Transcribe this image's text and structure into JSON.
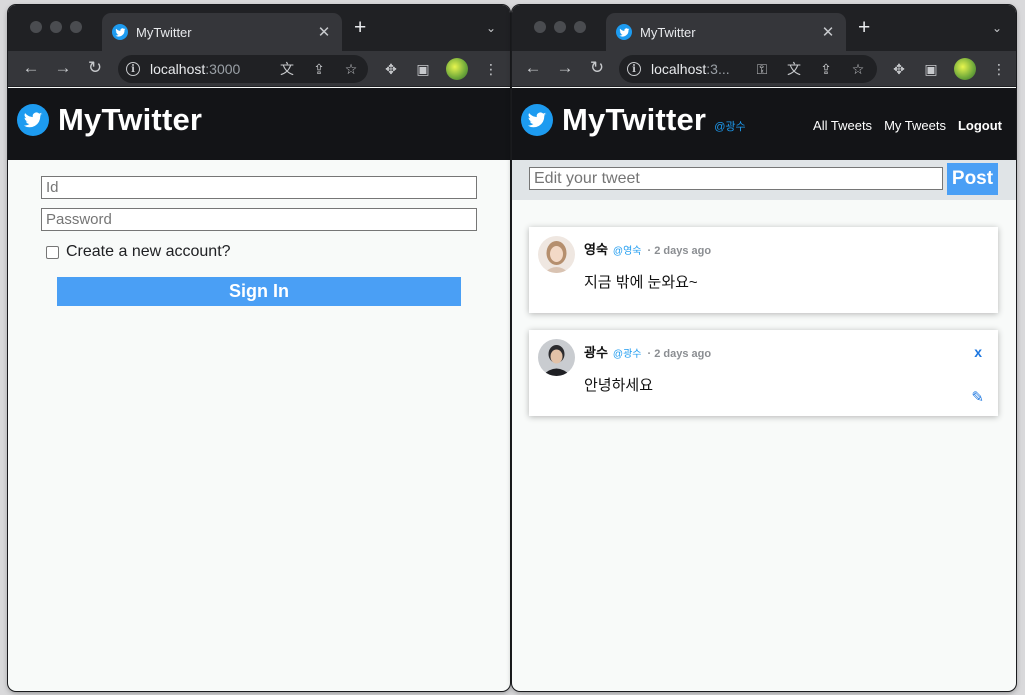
{
  "left_window": {
    "tab_title": "MyTwitter",
    "url_host": "localhost",
    "url_rest": ":3000",
    "app_title": "MyTwitter",
    "login": {
      "id_placeholder": "Id",
      "password_placeholder": "Password",
      "create_account_label": "Create a new account?",
      "create_account_checked": false,
      "signin_label": "Sign In"
    }
  },
  "right_window": {
    "tab_title": "MyTwitter",
    "url_host": "localhost",
    "url_rest": ":3...",
    "app_title": "MyTwitter",
    "user_handle": "@광수",
    "nav": {
      "all_tweets": "All Tweets",
      "my_tweets": "My Tweets",
      "logout": "Logout"
    },
    "composer": {
      "placeholder": "Edit your tweet",
      "post_label": "Post"
    },
    "tweets": [
      {
        "name": "영숙",
        "handle": "@영숙",
        "time": "· 2 days ago",
        "text": "지금 밖에 눈와요~",
        "owned": false
      },
      {
        "name": "광수",
        "handle": "@광수",
        "time": "· 2 days ago",
        "text": "안녕하세요",
        "owned": true,
        "delete_label": "x",
        "edit_label": "✎"
      }
    ]
  },
  "colors": {
    "accent": "#1d9bf0",
    "button": "#4a9ff5",
    "header": "#131417"
  },
  "icons": [
    "twitter-bird-icon",
    "info-icon",
    "translate-icon",
    "share-icon",
    "star-icon",
    "key-icon",
    "extensions-icon",
    "sidebar-icon",
    "profile-icon"
  ]
}
